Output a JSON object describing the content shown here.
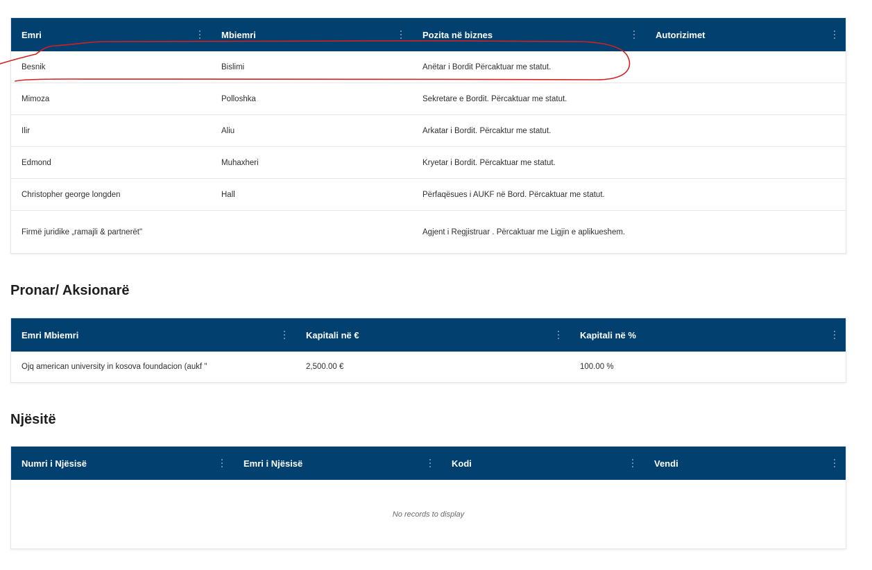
{
  "board_table": {
    "columns": [
      "Emri",
      "Mbiemri",
      "Pozita në biznes",
      "Autorizimet"
    ],
    "rows": [
      [
        "Besnik",
        "Bislimi",
        "Anëtar i Bordit Përcaktuar me statut.",
        ""
      ],
      [
        "Mimoza",
        "Polloshka",
        "Sekretare e Bordit. Përcaktuar me statut.",
        ""
      ],
      [
        "Ilir",
        "Aliu",
        "Arkatar i Bordit. Përcaktur me statut.",
        ""
      ],
      [
        "Edmond",
        "Muhaxheri",
        "Kryetar i Bordit. Përcaktuar me statut.",
        ""
      ],
      [
        "Christopher george longden",
        "Hall",
        "Përfaqësues i AUKF në Bord. Përcaktuar me statut.",
        ""
      ],
      [
        "Firmë juridike „ramajli & partnerët\"",
        "",
        "Agjent i Regjistruar . Përcaktuar me Ligjin e aplikueshem.",
        ""
      ]
    ]
  },
  "owners_section": {
    "title": "Pronar/ Aksionarë",
    "columns": [
      "Emri Mbiemri",
      "Kapitali në €",
      "Kapitali në %"
    ],
    "rows": [
      [
        "Ojq american university in kosova foundacion (aukf \"",
        "2,500.00 €",
        "100.00 %"
      ]
    ]
  },
  "units_section": {
    "title": "Njësitë",
    "columns": [
      "Numri i Njësisë",
      "Emri i Njësisë",
      "Kodi",
      "Vendi"
    ],
    "empty_message": "No records to display"
  },
  "colors": {
    "header_bg": "#02406f",
    "annotation": "#d42020"
  },
  "icons": {
    "column_menu": "vertical-ellipsis-icon"
  }
}
